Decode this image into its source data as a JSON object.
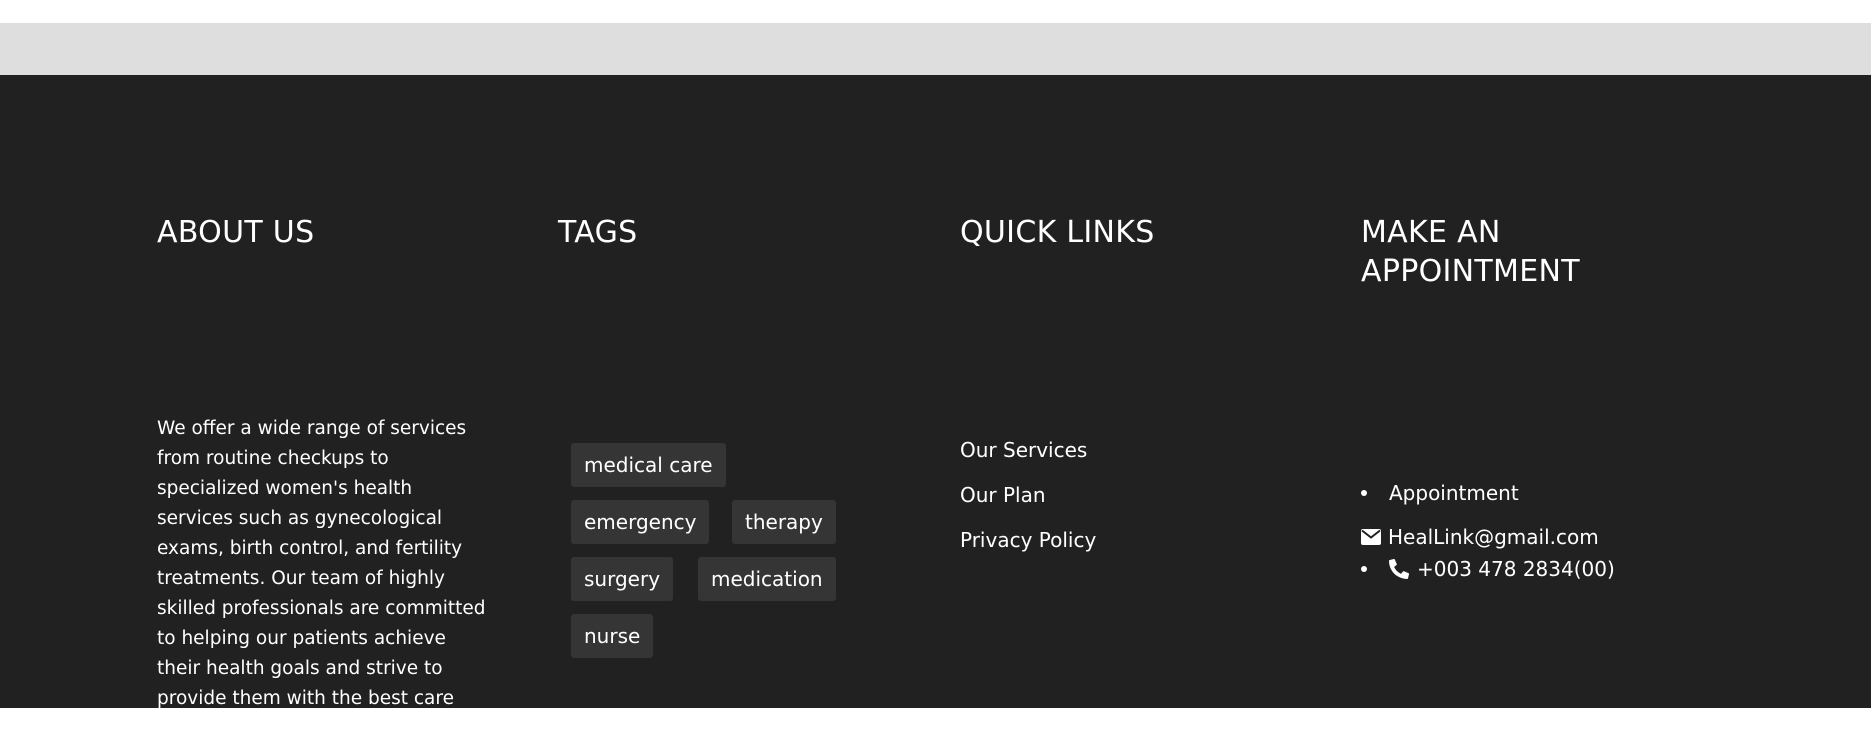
{
  "footer": {
    "about": {
      "heading": "ABOUT US",
      "text": "We offer a wide range of services from routine checkups to specialized women's health services such as gynecological exams, birth control, and fertility treatments. Our team of highly skilled professionals are committed to helping our patients achieve their health goals and strive to provide them with the best care possible."
    },
    "tags": {
      "heading": "TAGS",
      "items": [
        "medical care",
        "emergency",
        "therapy",
        "surgery",
        "medication",
        "nurse"
      ]
    },
    "quick_links": {
      "heading": "QUICK LINKS",
      "items": [
        "Our Services",
        "Our Plan",
        "Privacy Policy"
      ]
    },
    "appointment": {
      "heading_line1": "MAKE AN",
      "heading_line2": "APPOINTMENT",
      "label": "Appointment",
      "email": "HealLink@gmail.com",
      "phone": "+003 478 2834(00)",
      "email_icon": "envelope-icon",
      "phone_icon": "phone-icon"
    }
  },
  "colors": {
    "footer_bg": "#212121",
    "band_bg": "#dedede",
    "tag_bg": "#353535",
    "text": "#ffffff"
  }
}
